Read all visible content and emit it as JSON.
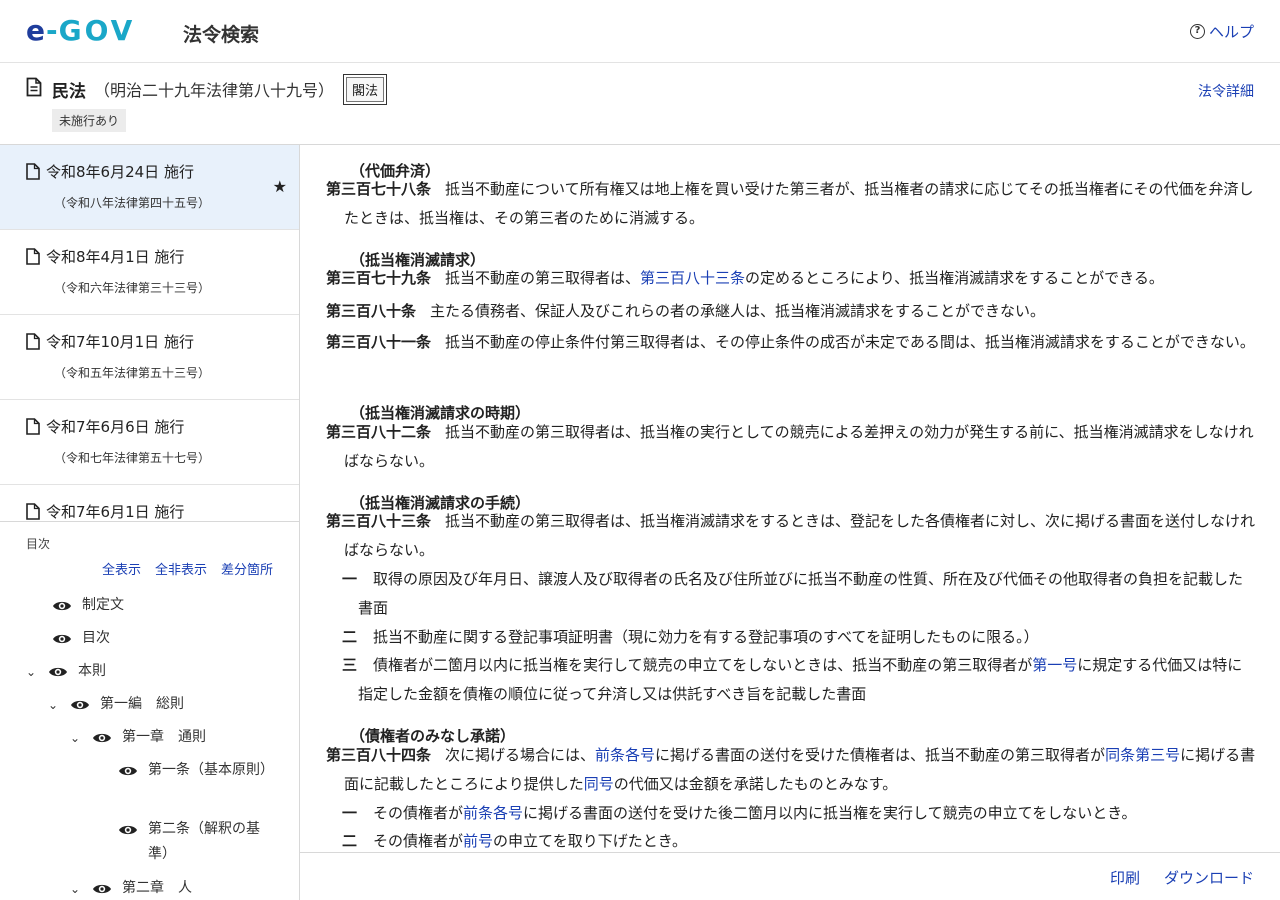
{
  "header": {
    "logo_e": "e",
    "logo_dash": "-",
    "logo_gov": "GOV",
    "app_title": "法令検索",
    "help_label": "ヘルプ"
  },
  "law": {
    "name": "民法",
    "number": "（明治二十九年法律第八十九号）",
    "type": "閣法",
    "status_badge": "未施行あり",
    "detail_link": "法令詳細"
  },
  "versions": [
    {
      "date": "令和8年6月24日 施行",
      "law": "（令和八年法律第四十五号）",
      "active": true
    },
    {
      "date": "令和8年4月1日 施行",
      "law": "（令和六年法律第三十三号）"
    },
    {
      "date": "令和7年10月1日 施行",
      "law": "（令和五年法律第五十三号）"
    },
    {
      "date": "令和7年6月6日 施行",
      "law": "（令和七年法律第五十七号）"
    },
    {
      "date": "令和7年6月1日 施行",
      "law": ""
    }
  ],
  "toc": {
    "label": "目次",
    "show_all": "全表示",
    "hide_all": "全非表示",
    "diff": "差分箇所",
    "items": [
      {
        "text": "制定文"
      },
      {
        "text": "目次"
      },
      {
        "text": "本則"
      },
      {
        "text": "第一編　総則"
      },
      {
        "text": "第一章　通則"
      },
      {
        "text": "第一条（基本原則）"
      },
      {
        "text": "第二条（解釈の基準）"
      },
      {
        "text": "第二章　人"
      }
    ]
  },
  "content": {
    "a378_caption": "（代価弁済）",
    "a378_num": "第三百七十八条",
    "a378_text": "抵当不動産について所有権又は地上権を買い受けた第三者が、抵当権者の請求に応じてその抵当権者にその代価を弁済したときは、抵当権は、その第三者のために消滅する。",
    "a379_caption": "（抵当権消滅請求）",
    "a379_num": "第三百七十九条",
    "a379_text1": "抵当不動産の第三取得者は、",
    "a379_link": "第三百八十三条",
    "a379_text2": "の定めるところにより、抵当権消滅請求をすることができる。",
    "a380_num": "第三百八十条",
    "a380_text": "主たる債務者、保証人及びこれらの者の承継人は、抵当権消滅請求をすることができない。",
    "a381_num": "第三百八十一条",
    "a381_text": "抵当不動産の停止条件付第三取得者は、その停止条件の成否が未定である間は、抵当権消滅請求をすることができない。",
    "a382_caption": "（抵当権消滅請求の時期）",
    "a382_num": "第三百八十二条",
    "a382_text": "抵当不動産の第三取得者は、抵当権の実行としての競売による差押えの効力が発生する前に、抵当権消滅請求をしなければならない。",
    "a383_caption": "（抵当権消滅請求の手続）",
    "a383_num": "第三百八十三条",
    "a383_text": "抵当不動産の第三取得者は、抵当権消滅請求をするときは、登記をした各債権者に対し、次に掲げる書面を送付しなければならない。",
    "a383_i1_num": "一",
    "a383_i1_text": "取得の原因及び年月日、譲渡人及び取得者の氏名及び住所並びに抵当不動産の性質、所在及び代価その他取得者の負担を記載した書面",
    "a383_i2_num": "二",
    "a383_i2_text": "抵当不動産に関する登記事項証明書（現に効力を有する登記事項のすべてを証明したものに限る。）",
    "a383_i3_num": "三",
    "a383_i3_text1": "債権者が二箇月以内に抵当権を実行して競売の申立てをしないときは、抵当不動産の第三取得者が",
    "a383_i3_link": "第一号",
    "a383_i3_text2": "に規定する代価又は特に指定した金額を債権の順位に従って弁済し又は供託すべき旨を記載した書面",
    "a384_caption": "（債権者のみなし承諾）",
    "a384_num": "第三百八十四条",
    "a384_text1": "次に掲げる場合には、",
    "a384_link1": "前条各号",
    "a384_text2": "に掲げる書面の送付を受けた債権者は、抵当不動産の第三取得者が",
    "a384_link2": "同条第三号",
    "a384_text3": "に掲げる書面に記載したところにより提供した",
    "a384_link3": "同号",
    "a384_text4": "の代価又は金額を承諾したものとみなす。",
    "a384_i1_num": "一",
    "a384_i1_text1": "その債権者が",
    "a384_i1_link": "前条各号",
    "a384_i1_text2": "に掲げる書面の送付を受けた後二箇月以内に抵当権を実行して競売の申立てをしないとき。",
    "a384_i2_num": "二",
    "a384_i2_text1": "その債権者が",
    "a384_i2_link": "前号",
    "a384_i2_text2": "の申立てを取り下げたとき。"
  },
  "footer": {
    "print": "印刷",
    "download": "ダウンロード"
  }
}
